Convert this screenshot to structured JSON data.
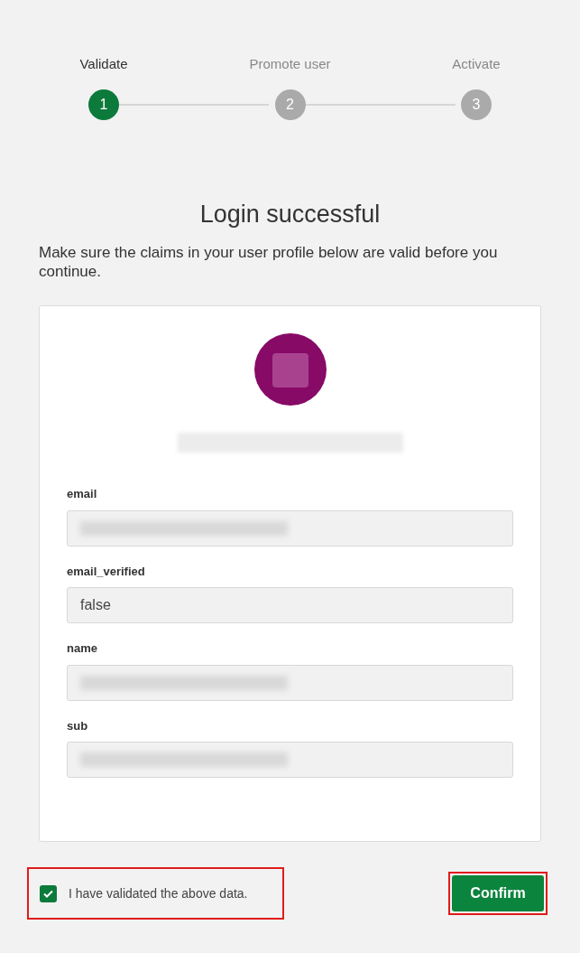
{
  "steps": [
    {
      "label": "Validate",
      "number": "1",
      "selected": true
    },
    {
      "label": "Promote user",
      "number": "2",
      "selected": false
    },
    {
      "label": "Activate",
      "number": "3",
      "selected": false
    }
  ],
  "title": "Login successful",
  "intro": "Make sure the claims in your user profile below are valid before you continue.",
  "profile": {
    "fields": [
      {
        "label": "email",
        "redacted": true
      },
      {
        "label": "email_verified",
        "value": "false",
        "redacted": false
      },
      {
        "label": "name",
        "redacted": true
      },
      {
        "label": "sub",
        "redacted": true
      }
    ]
  },
  "confirm_checkbox": {
    "label": "I have validated the above data.",
    "checked": true,
    "highlighted": true
  },
  "confirm_button": {
    "label": "Confirm",
    "highlighted": true
  }
}
